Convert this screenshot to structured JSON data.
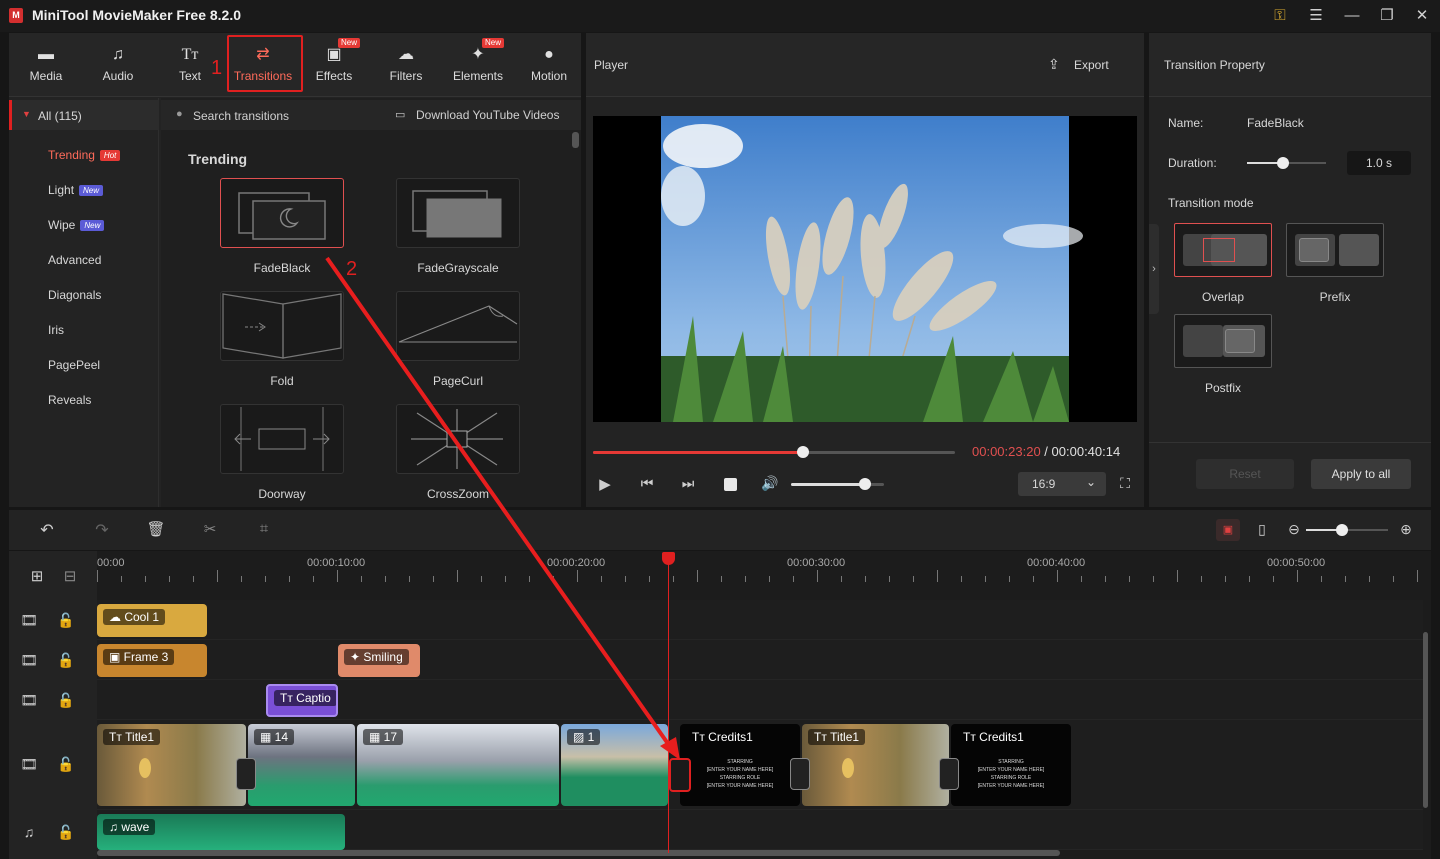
{
  "app": {
    "title": "MiniTool MovieMaker Free 8.2.0"
  },
  "toolbar": {
    "items": [
      {
        "label": "Media"
      },
      {
        "label": "Audio"
      },
      {
        "label": "Text"
      },
      {
        "label": "Transitions"
      },
      {
        "label": "Effects",
        "badge": "New"
      },
      {
        "label": "Filters"
      },
      {
        "label": "Elements",
        "badge": "New"
      },
      {
        "label": "Motion"
      }
    ]
  },
  "annotations": {
    "step1": "1",
    "step2": "2"
  },
  "categories": {
    "all": "All (115)",
    "items": [
      {
        "label": "Trending",
        "badge": "Hot"
      },
      {
        "label": "Light",
        "badge": "New"
      },
      {
        "label": "Wipe",
        "badge": "New"
      },
      {
        "label": "Advanced"
      },
      {
        "label": "Diagonals"
      },
      {
        "label": "Iris"
      },
      {
        "label": "PagePeel"
      },
      {
        "label": "Reveals"
      }
    ]
  },
  "search": {
    "placeholder": "Search transitions",
    "download_label": "Download YouTube Videos"
  },
  "section_title": "Trending",
  "transitions": [
    {
      "label": "FadeBlack"
    },
    {
      "label": "FadeGrayscale"
    },
    {
      "label": "Fold"
    },
    {
      "label": "PageCurl"
    },
    {
      "label": "Doorway"
    },
    {
      "label": "CrossZoom"
    }
  ],
  "player": {
    "title": "Player",
    "export_label": "Export",
    "current_time": "00:00:23:20",
    "separator": " / ",
    "total_time": "00:00:40:14",
    "aspect_ratio": "16:9",
    "progress": 0.58,
    "volume": 0.8
  },
  "property": {
    "title": "Transition Property",
    "name_label": "Name:",
    "name_value": "FadeBlack",
    "duration_label": "Duration:",
    "duration_value": "1.0 s",
    "mode_label": "Transition mode",
    "modes": [
      {
        "label": "Overlap"
      },
      {
        "label": "Prefix"
      },
      {
        "label": "Postfix"
      }
    ],
    "reset_label": "Reset",
    "apply_label": "Apply to all"
  },
  "timeline": {
    "ruler": [
      "00:00",
      "00:00:10:00",
      "00:00:20:00",
      "00:00:30:00",
      "00:00:40:00",
      "00:00:50:00"
    ],
    "clips": {
      "cool": "Cool 1",
      "frame": "Frame 3",
      "smiling": "Smiling",
      "caption": "Captio",
      "title1_a": "Title1",
      "clip14": "14",
      "clip17": "17",
      "clip1": "1",
      "credits_a": "Credits1",
      "title1_b": "Title1",
      "credits_b": "Credits1",
      "wave": "wave"
    },
    "credits_text": [
      "STARRING",
      "[ENTER YOUR NAME HERE]",
      "STARRING ROLE",
      "[ENTER YOUR NAME HERE]"
    ]
  },
  "colors": {
    "accent": "#e02020",
    "audio": "#1f9e6e",
    "cool_clip": "#d9a93f",
    "frame_clip": "#c8862e",
    "smiling_clip": "#e08a6a",
    "caption_clip": "#7a4fd6"
  }
}
